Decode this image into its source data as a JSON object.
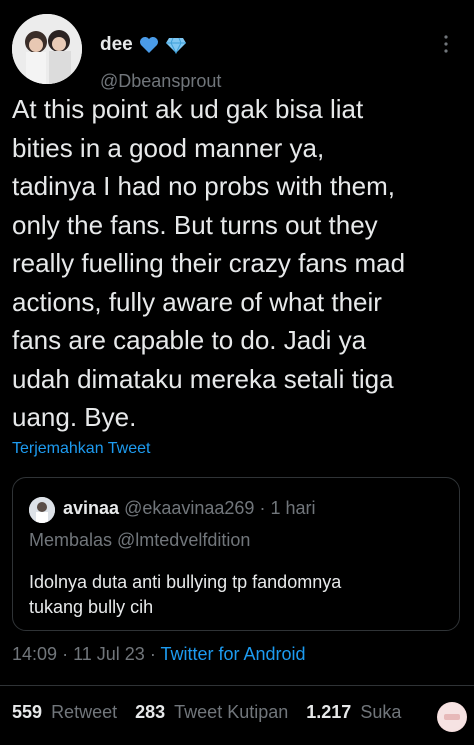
{
  "author": {
    "display_name": "dee",
    "handle": "@Dbeansprout",
    "badges": [
      "blue-heart-icon",
      "blue-diamond-icon"
    ]
  },
  "tweet": {
    "text": "At this point ak ud gak bisa liat\nbities in a good manner ya,\ntadinya I had no probs with them,\nonly the fans. But turns out they\nreally fuelling their crazy fans mad\nactions, fully aware of what their\nfans are capable to do. Jadi ya\nudah dimataku mereka setali tiga\nuang. Bye.",
    "translate_label": "Terjemahkan Tweet"
  },
  "quote": {
    "name": "avinaa",
    "handle": "@ekaavinaa269",
    "time": "1 hari",
    "replying_to": "Membalas @lmtedvelfdition",
    "text": "Idolnya duta anti bullying tp fandomnya\ntukang bully cih"
  },
  "meta": {
    "time": "14:09",
    "date": "11 Jul 23",
    "source": "Twitter for Android",
    "sep": "·"
  },
  "stats": {
    "retweets": "559",
    "retweets_label": "Retweet",
    "quotes": "283",
    "quotes_label": "Tweet Kutipan",
    "likes": "1.217",
    "likes_label": "Suka"
  },
  "colors": {
    "background": "#000000",
    "text": "#e7e9ea",
    "muted": "#71767b",
    "link": "#1d9bf0",
    "border": "#2f3336"
  }
}
